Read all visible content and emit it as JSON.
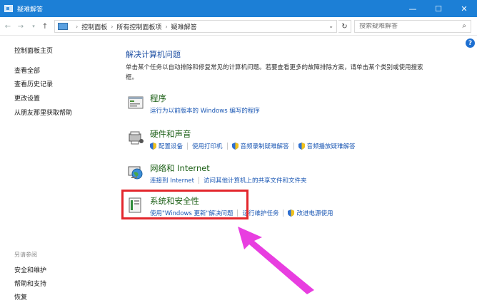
{
  "window": {
    "title": "疑难解答",
    "controls": {
      "minimize": "—",
      "maximize": "☐",
      "close": "✕"
    }
  },
  "address": {
    "breadcrumbs": [
      "控制面板",
      "所有控制面板项",
      "疑难解答"
    ],
    "search_placeholder": "搜索疑难解答"
  },
  "sidebar": {
    "links": [
      "控制面板主页",
      "查看全部",
      "查看历史记录",
      "更改设置",
      "从朋友那里获取帮助"
    ],
    "see_also_heading": "另请参阅",
    "see_also": [
      "安全和维护",
      "帮助和支持",
      "恢复"
    ]
  },
  "main": {
    "title": "解决计算机问题",
    "description_lines": [
      "单击某个任务以自动排除和修复常见的计算机问题。若要查看更多的故障排除方案，请单击某个类别或使用搜索",
      "框。"
    ],
    "categories": [
      {
        "title": "程序",
        "links": [
          {
            "label": "运行为以前版本的 Windows 编写的程序",
            "shield": false
          }
        ]
      },
      {
        "title": "硬件和声音",
        "links": [
          {
            "label": "配置设备",
            "shield": true
          },
          {
            "label": "使用打印机",
            "shield": false
          },
          {
            "label": "音频录制疑难解答",
            "shield": true
          },
          {
            "label": "音频播放疑难解答",
            "shield": true
          }
        ]
      },
      {
        "title": "网络和 Internet",
        "links": [
          {
            "label": "连接到 Internet",
            "shield": false
          },
          {
            "label": "访问其他计算机上的共享文件和文件夹",
            "shield": false
          }
        ]
      },
      {
        "title": "系统和安全性",
        "links": [
          {
            "label": "使用\"Windows 更新\"解决问题",
            "shield": false
          },
          {
            "label": "运行维护任务",
            "shield": false
          },
          {
            "label": "改进电源使用",
            "shield": true
          }
        ]
      }
    ]
  },
  "colors": {
    "titlebar": "#1c7fd6",
    "link": "#1c58b4",
    "category_title": "#1a5e14",
    "highlight": "#e3262c",
    "arrow": "#e83ee0"
  }
}
